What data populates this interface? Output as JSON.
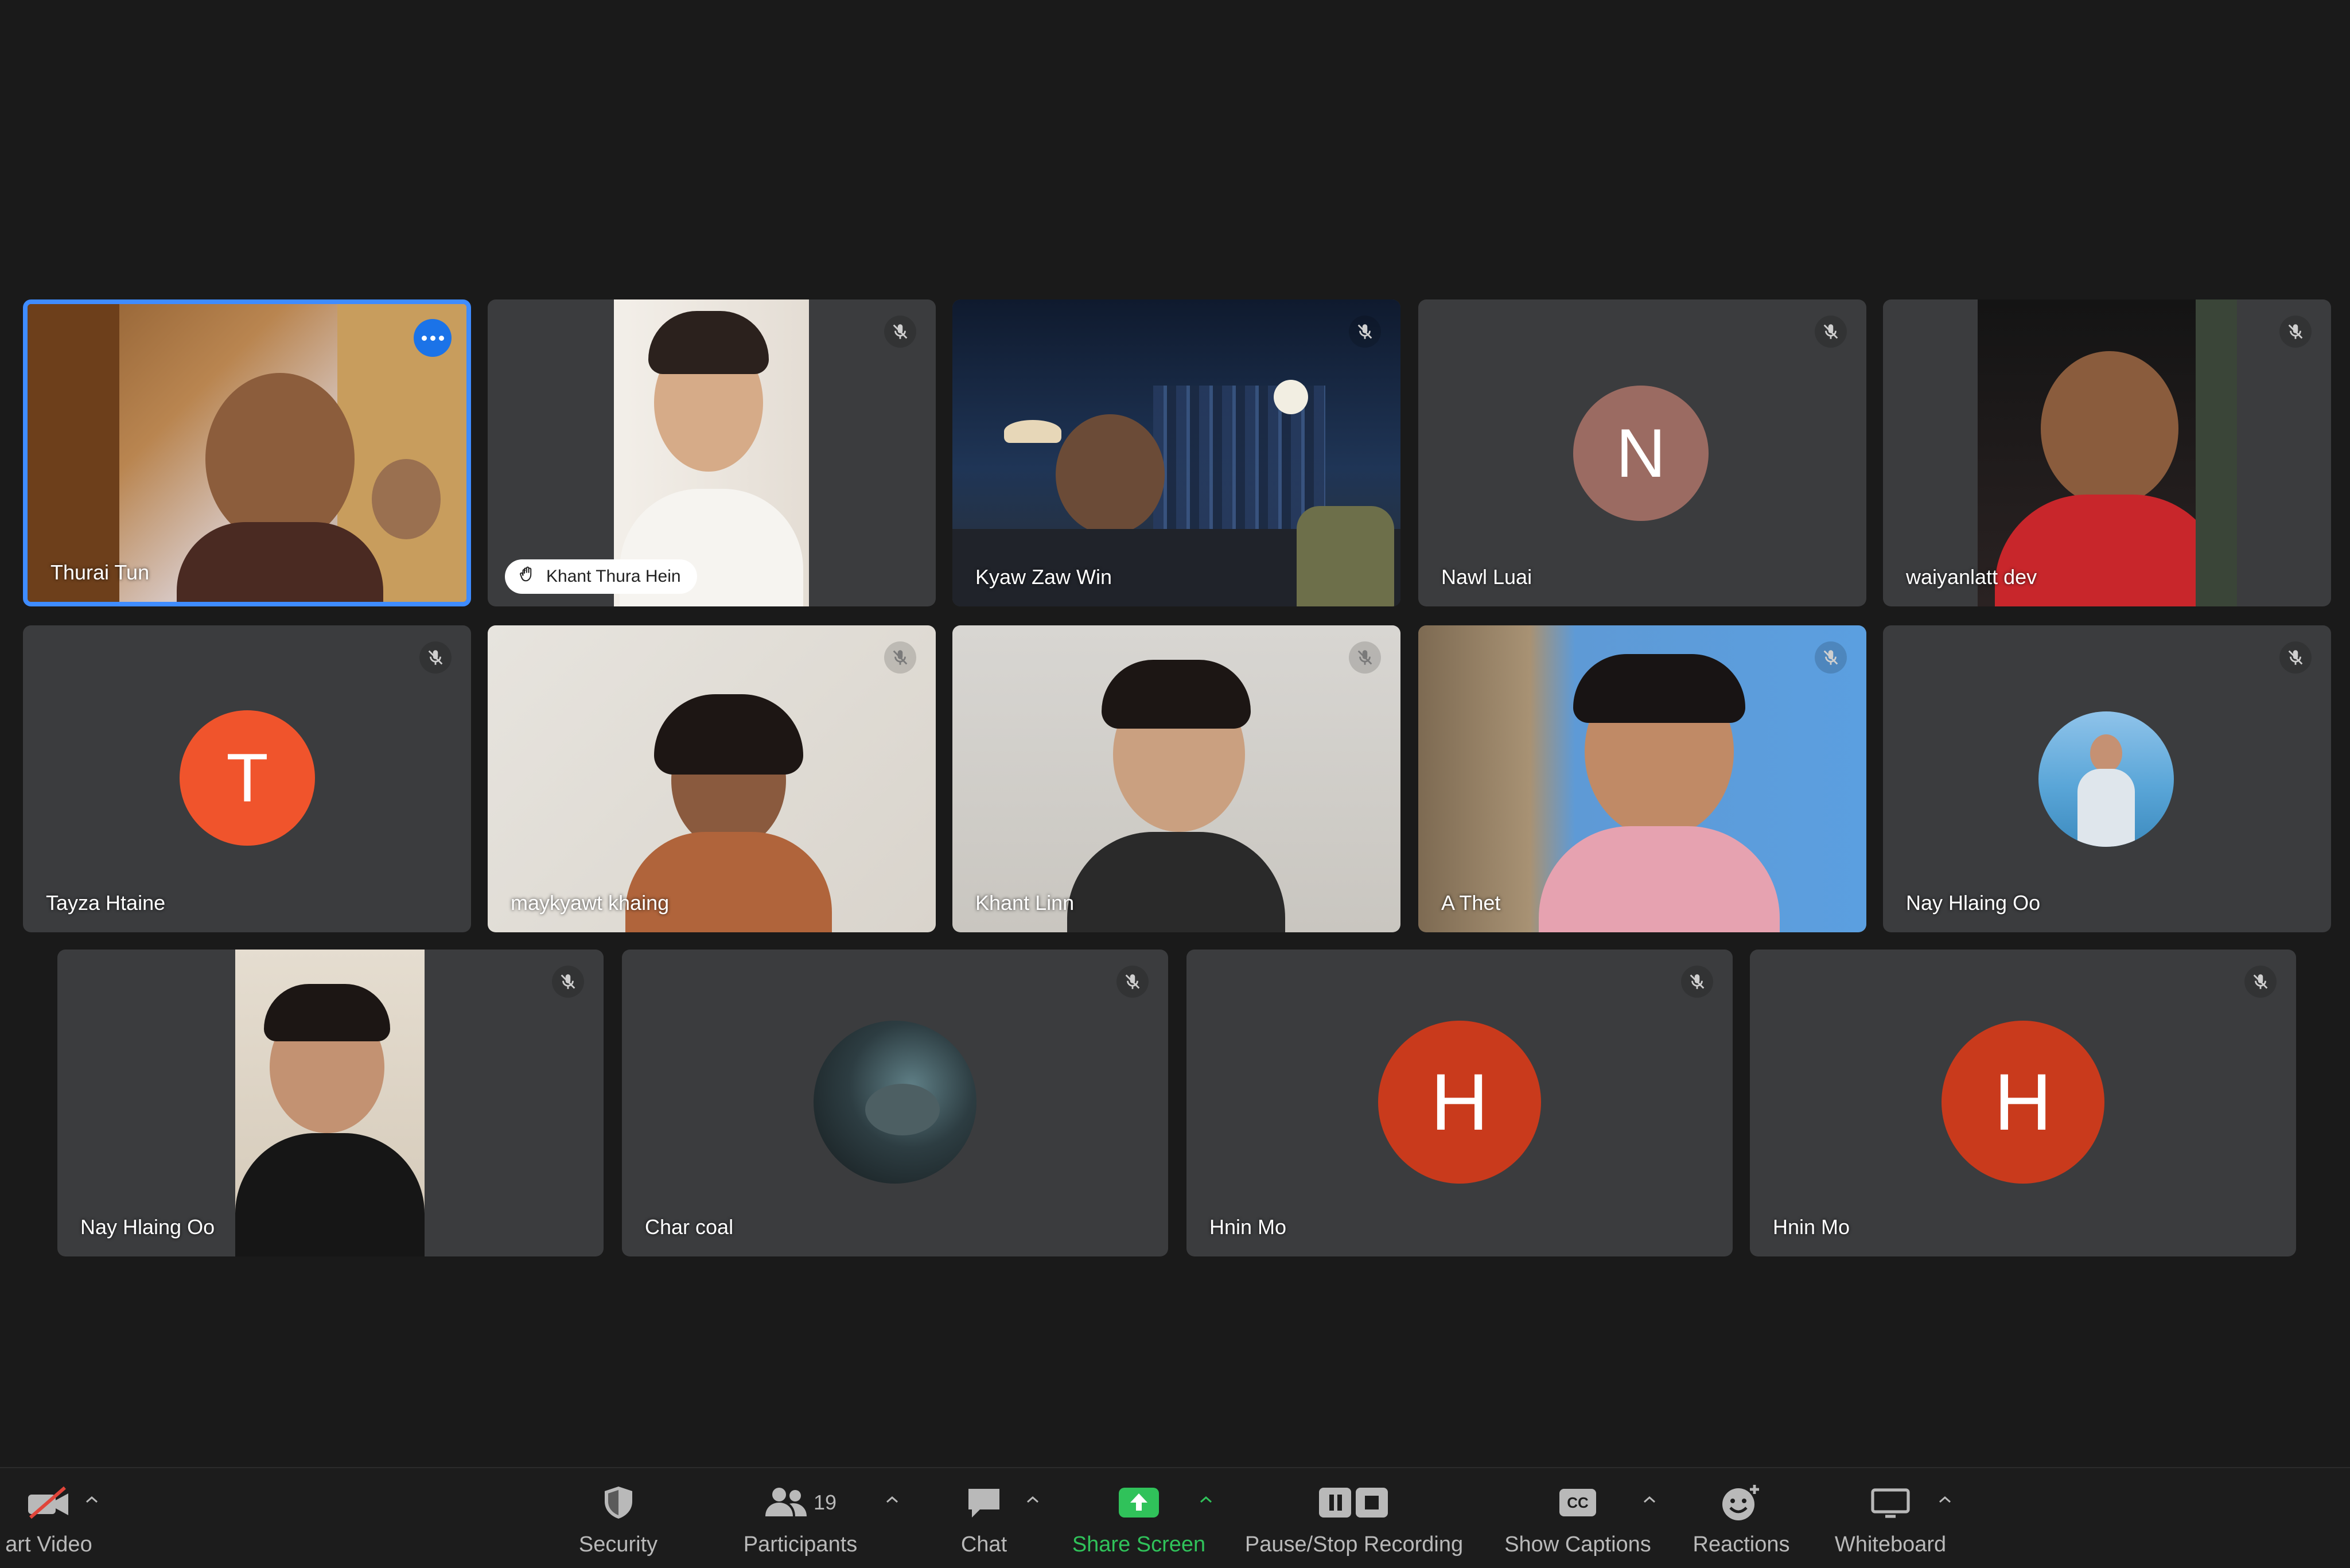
{
  "gallery": {
    "tiles": [
      {
        "name": "Thurai Tun",
        "active": true
      },
      {
        "name": "Khant Thura Hein",
        "hand_raised": true
      },
      {
        "name": "Kyaw Zaw Win"
      },
      {
        "name": "Nawl Luai",
        "avatar_letter": "N",
        "avatar_color": "#9b6b62"
      },
      {
        "name": "waiyanlatt dev"
      },
      {
        "name": "Tayza Htaine",
        "avatar_letter": "T",
        "avatar_color": "#f0542c"
      },
      {
        "name": "maykyawt khaing"
      },
      {
        "name": "Khant Linn"
      },
      {
        "name": "A Thet"
      },
      {
        "name": "Nay Hlaing Oo"
      },
      {
        "name": "Nay Hlaing Oo"
      },
      {
        "name": "Char coal"
      },
      {
        "name": "Hnin Mo",
        "avatar_letter": "H",
        "avatar_color": "#c93a1c"
      },
      {
        "name": "Hnin Mo",
        "avatar_letter": "H",
        "avatar_color": "#c93a1c"
      }
    ]
  },
  "toolbar": {
    "start_video": "art Video",
    "security": "Security",
    "participants": "Participants",
    "participants_count": "19",
    "chat": "Chat",
    "share_screen": "Share Screen",
    "recording": "Pause/Stop Recording",
    "captions": "Show Captions",
    "captions_icon_text": "CC",
    "reactions": "Reactions",
    "whiteboard": "Whiteboard"
  },
  "colors": {
    "active_border": "#3f8cff",
    "share_green": "#30c25a",
    "tile_bg": "#3b3c3e"
  }
}
